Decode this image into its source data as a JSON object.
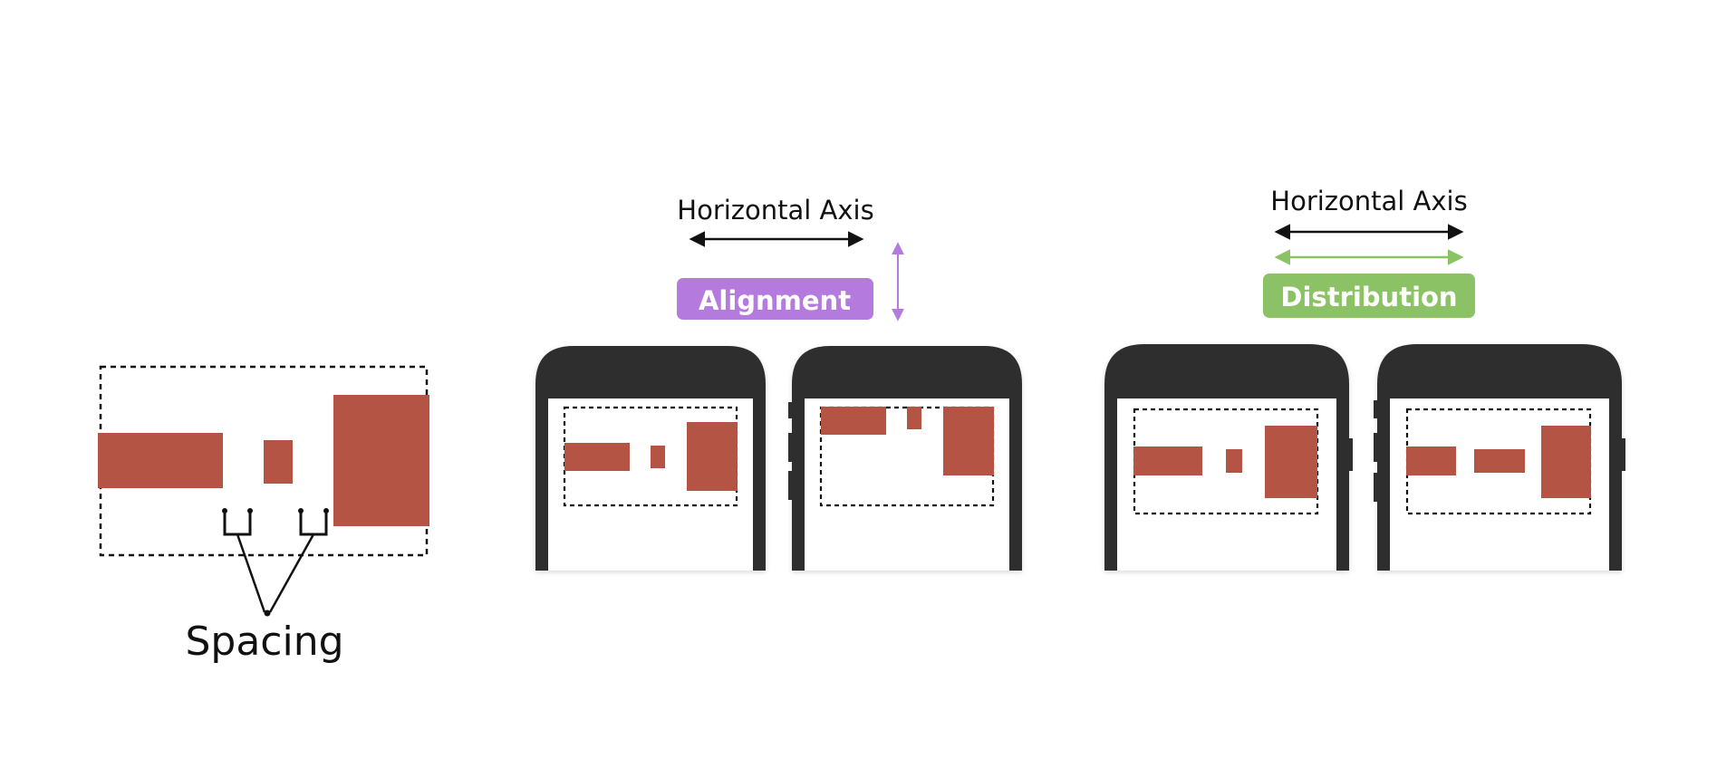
{
  "spacing_panel": {
    "label": "Spacing"
  },
  "alignment_panel": {
    "axis_label": "Horizontal Axis",
    "badge_label": "Alignment",
    "badge_color": "#b57ade"
  },
  "distribution_panel": {
    "axis_label": "Horizontal Axis",
    "badge_label": "Distribution",
    "badge_color": "#8cc266"
  },
  "colors": {
    "box_fill": "#b45444",
    "phone_body": "#2e2e2e",
    "axis_arrow": "#111111"
  }
}
